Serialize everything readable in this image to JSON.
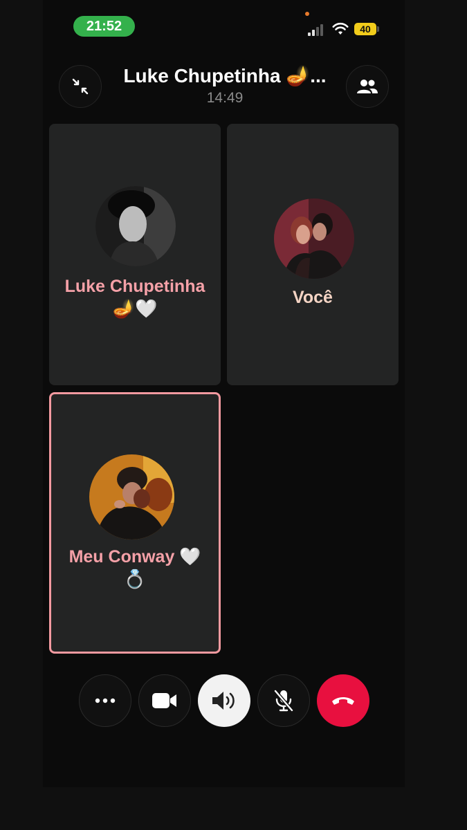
{
  "status_bar": {
    "time": "21:52",
    "battery": "40"
  },
  "header": {
    "title": "Luke Chupetinha 🪔...",
    "duration": "14:49"
  },
  "participants": [
    {
      "name": "Luke Chupetinha",
      "emoji_line": "🪔🤍",
      "name_color": "#f5a1a8"
    },
    {
      "name": "Você",
      "emoji_line": "",
      "name_color": "#f4d4c4"
    },
    {
      "name": "Meu Conway 🤍",
      "emoji_line": "💍",
      "name_color": "#f5a1a8"
    }
  ],
  "controls": {
    "more": "more-icon",
    "video": "video-camera-icon",
    "speaker": "speaker-icon",
    "mic": "microphone-muted-icon",
    "end": "end-call-icon"
  },
  "colors": {
    "accent": "#f39aa0",
    "end_call": "#e8103f",
    "time_pill": "#34b14c",
    "battery": "#f2cc1b"
  }
}
